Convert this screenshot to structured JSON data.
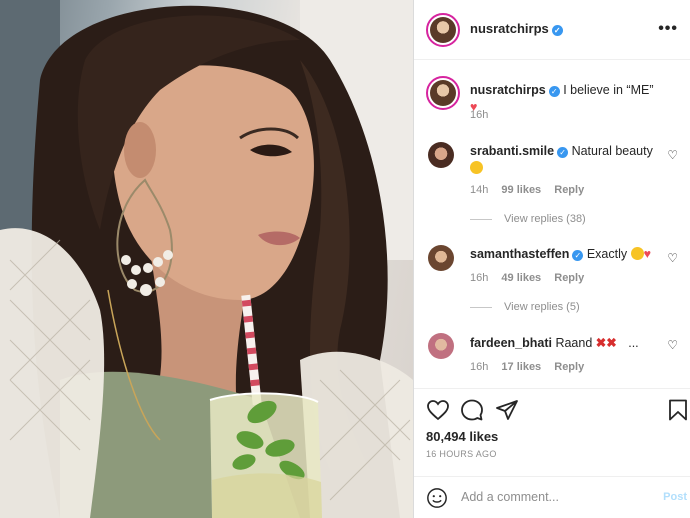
{
  "post": {
    "author": "nusratchirps",
    "caption": "I believe in “ME”",
    "caption_emoji": "red-heart",
    "caption_time": "16h",
    "likes": "80,494 likes",
    "time_ago": "16 HOURS AGO"
  },
  "comments": [
    {
      "user": "srabanti.smile",
      "verified": true,
      "text": "Natural beauty",
      "emoji": "heart-eyes",
      "time": "14h",
      "likes": "99 likes",
      "reply": "Reply",
      "view_replies": "View replies (38)"
    },
    {
      "user": "samanthasteffen",
      "verified": true,
      "text": "Exactly",
      "emoji": "clapping-hands red-heart",
      "time": "16h",
      "likes": "49 likes",
      "reply": "Reply",
      "view_replies": "View replies (5)"
    },
    {
      "user": "fardeen_bhati",
      "verified": false,
      "text": "Raand",
      "emoji": "cross-mark cross-mark",
      "more": "...",
      "time": "16h",
      "likes": "17 likes",
      "reply": "Reply"
    }
  ],
  "input": {
    "placeholder": "Add a comment...",
    "post_label": "Post"
  },
  "header_more": "•••",
  "colors": {
    "verified": "#3897f0",
    "heart": "#ed4956",
    "post_disabled": "#b2dffc",
    "ring": "#d6249f"
  }
}
